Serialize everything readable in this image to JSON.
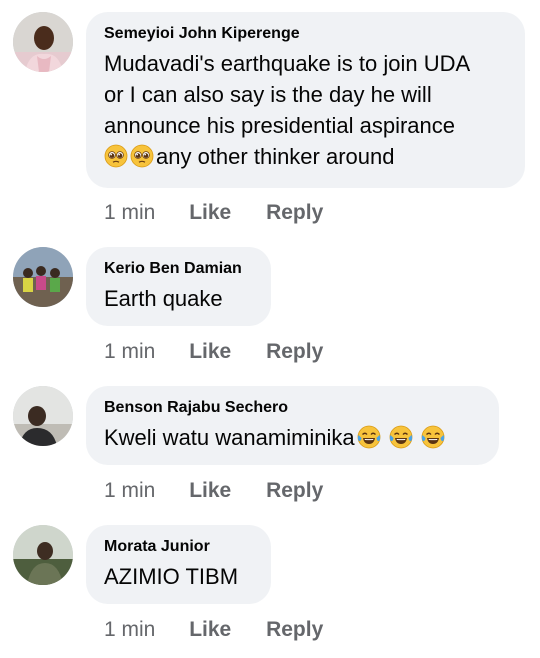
{
  "comments": [
    {
      "author": "Semeyioi John Kiperenge",
      "lines": [
        "Mudavadi's earthquake is to join UDA",
        "or I can also say is the day he will",
        "announce his presidential aspirance"
      ],
      "tail_text": "any other thinker around",
      "emojis": [
        "pleading-face",
        "pleading-face"
      ],
      "time": "1 min",
      "like_label": "Like",
      "reply_label": "Reply"
    },
    {
      "author": "Kerio Ben Damian",
      "text": "Earth quake",
      "time": "1 min",
      "like_label": "Like",
      "reply_label": "Reply"
    },
    {
      "author": "Benson Rajabu Sechero",
      "text": "Kweli watu wanamiminika",
      "emojis": [
        "tears-of-joy",
        "tears-of-joy",
        "tears-of-joy"
      ],
      "time": "1 min",
      "like_label": "Like",
      "reply_label": "Reply"
    },
    {
      "author": "Morata Junior",
      "text": "AZIMIO TIBM",
      "time": "1 min",
      "like_label": "Like",
      "reply_label": "Reply"
    }
  ],
  "colors": {
    "bubble": "#f0f2f5",
    "author": "#050505",
    "meta": "#65676b"
  }
}
